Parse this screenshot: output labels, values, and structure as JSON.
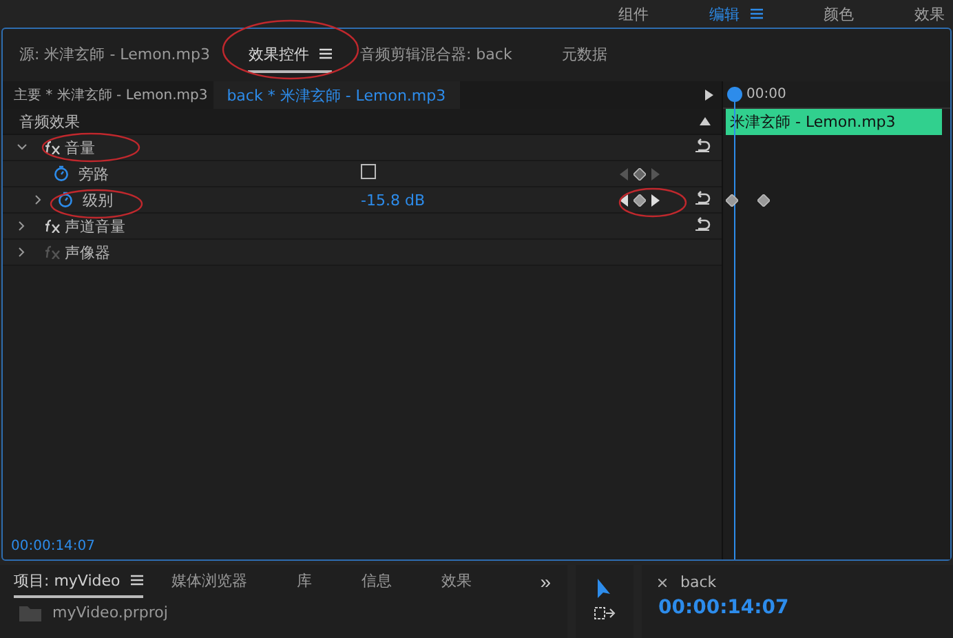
{
  "workspaces": [
    {
      "label": "组件",
      "selected": false
    },
    {
      "label": "编辑",
      "selected": true
    },
    {
      "label": "颜色",
      "selected": false
    },
    {
      "label": "效果",
      "selected": false
    }
  ],
  "panel_tabs": [
    {
      "label": "源: 米津玄師 - Lemon.mp3",
      "selected": false
    },
    {
      "label": "效果控件",
      "selected": true
    },
    {
      "label": "音频剪辑混合器: back",
      "selected": false
    },
    {
      "label": "元数据",
      "selected": false
    }
  ],
  "clip_selector": {
    "master": "主要 * 米津玄師 - Lemon.mp3",
    "clip": "back * 米津玄師 - Lemon.mp3"
  },
  "section": "音频效果",
  "effects": [
    {
      "name": "音量",
      "expanded": true,
      "enabled": true,
      "properties": [
        {
          "name": "旁路",
          "kind": "checkbox",
          "checked": false,
          "keyframed": false
        },
        {
          "name": "级别",
          "kind": "value",
          "value": "-15.8 dB",
          "keyframed": true
        }
      ]
    },
    {
      "name": "声道音量",
      "expanded": false,
      "enabled": true
    },
    {
      "name": "声像器",
      "expanded": false,
      "enabled": false
    }
  ],
  "timeline": {
    "ruler": "00:00",
    "clip": "米津玄師 - Lemon.mp3"
  },
  "timecode": "00:00:14:07",
  "bottom_tabs": [
    {
      "label": "项目: myVideo",
      "selected": true
    },
    {
      "label": "媒体浏览器",
      "selected": false
    },
    {
      "label": "库",
      "selected": false
    },
    {
      "label": "信息",
      "selected": false
    },
    {
      "label": "效果",
      "selected": false
    }
  ],
  "overflow": "»",
  "project_item": "myVideo.prproj",
  "program": {
    "tab": "back",
    "timecode": "00:00:14:07"
  }
}
